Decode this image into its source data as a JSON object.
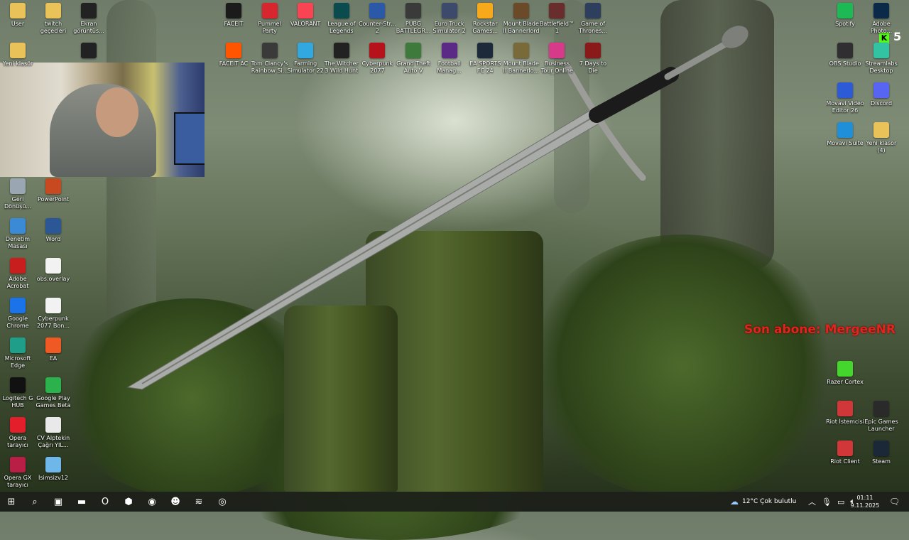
{
  "desktop": {
    "icons_left_col1": [
      {
        "label": "User",
        "icon": "folder-icon",
        "color": "#e9c25a"
      },
      {
        "label": "Yeni klasör",
        "icon": "folder-icon",
        "color": "#e9c25a"
      },
      {
        "label": "Geri Dönüşü...",
        "icon": "recycle-bin-icon",
        "color": "#9aa6b2"
      },
      {
        "label": "Denetim Masası",
        "icon": "control-panel-icon",
        "color": "#3a8ad6"
      },
      {
        "label": "Adobe Acrobat",
        "icon": "acrobat-icon",
        "color": "#c81e1e"
      },
      {
        "label": "Google Chrome",
        "icon": "chrome-icon",
        "color": "#1a73e8"
      },
      {
        "label": "Microsoft Edge",
        "icon": "edge-icon",
        "color": "#1f9e8a"
      },
      {
        "label": "Logitech G HUB",
        "icon": "logitech-icon",
        "color": "#111111"
      },
      {
        "label": "Opera tarayıcı",
        "icon": "opera-icon",
        "color": "#e51e2b"
      },
      {
        "label": "Opera GX tarayıcı",
        "icon": "opera-gx-icon",
        "color": "#b81e46"
      }
    ],
    "icons_left_col2": [
      {
        "label": "twitch geçecleri",
        "icon": "folder-icon",
        "color": "#e9c25a"
      },
      {
        "label": "PowerPoint",
        "icon": "powerpoint-icon",
        "color": "#c8491f"
      },
      {
        "label": "Word",
        "icon": "word-icon",
        "color": "#2b5797"
      },
      {
        "label": "obs.overlay",
        "icon": "file-icon",
        "color": "#f2f2f2"
      },
      {
        "label": "Cyberpunk 2077 Bon...",
        "icon": "file-icon",
        "color": "#f2f2f2"
      },
      {
        "label": "EA",
        "icon": "ea-icon",
        "color": "#ef5a24"
      },
      {
        "label": "Google Play Games Beta",
        "icon": "google-play-icon",
        "color": "#2bb24c"
      },
      {
        "label": "CV Alptekin Çağrı YIL...",
        "icon": "pdf-icon",
        "color": "#e9e9e9"
      },
      {
        "label": "İsimsizv12",
        "icon": "image-file-icon",
        "color": "#6fb7e8"
      }
    ],
    "icons_left_col3": [
      {
        "label": "Ekran görüntüs...",
        "icon": "screenshot-icon",
        "color": "#222222"
      },
      {
        "label": "",
        "icon": "shortcut-icon",
        "color": "#222222"
      }
    ],
    "icons_top_row1": [
      {
        "label": "FACEIT",
        "icon": "faceit-icon",
        "color": "#1b1b1b"
      },
      {
        "label": "Pummel Party",
        "icon": "pummel-party-icon",
        "color": "#d8262f"
      },
      {
        "label": "VALORANT",
        "icon": "valorant-icon",
        "color": "#fa4454"
      },
      {
        "label": "League of Legends",
        "icon": "lol-icon",
        "color": "#0b4a4d"
      },
      {
        "label": "Counter-Str... 2",
        "icon": "cs2-icon",
        "color": "#2b58a7"
      },
      {
        "label": "PUBG BATTLEGR...",
        "icon": "pubg-icon",
        "color": "#3a3a3a"
      },
      {
        "label": "Euro Truck Simulator 2",
        "icon": "ets2-icon",
        "color": "#3d4a6b"
      },
      {
        "label": "Rockstar Games...",
        "icon": "rockstar-icon",
        "color": "#f7a81b"
      },
      {
        "label": "Mount Blade II Bannerlord",
        "icon": "bannerlord-icon",
        "color": "#6b4a2a"
      },
      {
        "label": "Battlefield™ 1",
        "icon": "battlefield-icon",
        "color": "#6a2d2d"
      },
      {
        "label": "Game of Thrones...",
        "icon": "got-icon",
        "color": "#2e3f5e"
      }
    ],
    "icons_top_row2": [
      {
        "label": "FACEIT AC",
        "icon": "faceit-ac-icon",
        "color": "#ff5500"
      },
      {
        "label": "Tom Clancy's Rainbow Si...",
        "icon": "rainbow-six-icon",
        "color": "#3a3a3a"
      },
      {
        "label": "Farming Simulator 22",
        "icon": "farming-sim-icon",
        "color": "#31a8e0"
      },
      {
        "label": "The Witcher 3 Wild Hunt",
        "icon": "witcher-icon",
        "color": "#222222"
      },
      {
        "label": "Cyberpunk 2077",
        "icon": "cyberpunk-icon",
        "color": "#b5121b"
      },
      {
        "label": "Grand Theft Auto V",
        "icon": "gta-icon",
        "color": "#3d7a3c"
      },
      {
        "label": "Football Manag...",
        "icon": "football-manager-icon",
        "color": "#5b2a86"
      },
      {
        "label": "EA SPORTS FC 24",
        "icon": "ea-fc-icon",
        "color": "#1d2a3a"
      },
      {
        "label": "Mount Blade II Bannerlo...",
        "icon": "bannerlord-icon",
        "color": "#7a6a3a"
      },
      {
        "label": "Business Tour Online Mu...",
        "icon": "business-tour-icon",
        "color": "#d83a8a"
      },
      {
        "label": "7 Days to Die",
        "icon": "7-days-icon",
        "color": "#8a1a1a"
      }
    ],
    "icons_right_col1": [
      {
        "label": "Spotify",
        "icon": "spotify-icon",
        "color": "#1db954"
      },
      {
        "label": "OBS Studio",
        "icon": "obs-icon",
        "color": "#302e31"
      },
      {
        "label": "Movavi Video Editor 26",
        "icon": "movavi-icon",
        "color": "#2d5bd8"
      },
      {
        "label": "Movavi Suite",
        "icon": "movavi-suite-icon",
        "color": "#1e8fd8"
      },
      {
        "label": "Razer Cortex",
        "icon": "razer-icon",
        "color": "#44d62c"
      },
      {
        "label": "Riot İstemcisi",
        "icon": "riot-icon",
        "color": "#d13639"
      },
      {
        "label": "Riot Client",
        "icon": "riot-icon",
        "color": "#d13639"
      }
    ],
    "icons_right_col2": [
      {
        "label": "Adobe Photo...",
        "icon": "photoshop-icon",
        "color": "#0b2a4a"
      },
      {
        "label": "Streamlabs Desktop",
        "icon": "streamlabs-icon",
        "color": "#31c3a2"
      },
      {
        "label": "Discord",
        "icon": "discord-icon",
        "color": "#5865f2"
      },
      {
        "label": "Yeni klasör (4)",
        "icon": "folder-icon",
        "color": "#e9c25a"
      },
      {
        "label": "Epic Games Launcher",
        "icon": "epic-icon",
        "color": "#2a2a2a"
      },
      {
        "label": "Steam",
        "icon": "steam-icon",
        "color": "#1b2838"
      }
    ]
  },
  "overlay": {
    "last_subscriber": "Son abone: MergeeNR",
    "counter": "5"
  },
  "taskbar": {
    "items": [
      {
        "icon": "windows-start-icon",
        "glyph": "⊞"
      },
      {
        "icon": "search-icon",
        "glyph": "⌕"
      },
      {
        "icon": "task-view-icon",
        "glyph": "▣"
      },
      {
        "icon": "file-explorer-icon",
        "glyph": "▬"
      },
      {
        "icon": "opera-icon",
        "glyph": "O"
      },
      {
        "icon": "app-icon",
        "glyph": "⬢"
      },
      {
        "icon": "chrome-icon",
        "glyph": "◉"
      },
      {
        "icon": "discord-icon",
        "glyph": "☻"
      },
      {
        "icon": "spotify-icon",
        "glyph": "≋"
      },
      {
        "icon": "obs-icon",
        "glyph": "◎"
      }
    ],
    "weather": "12°C  Çok bulutlu",
    "time": "01:11",
    "date": "9.11.2025"
  }
}
